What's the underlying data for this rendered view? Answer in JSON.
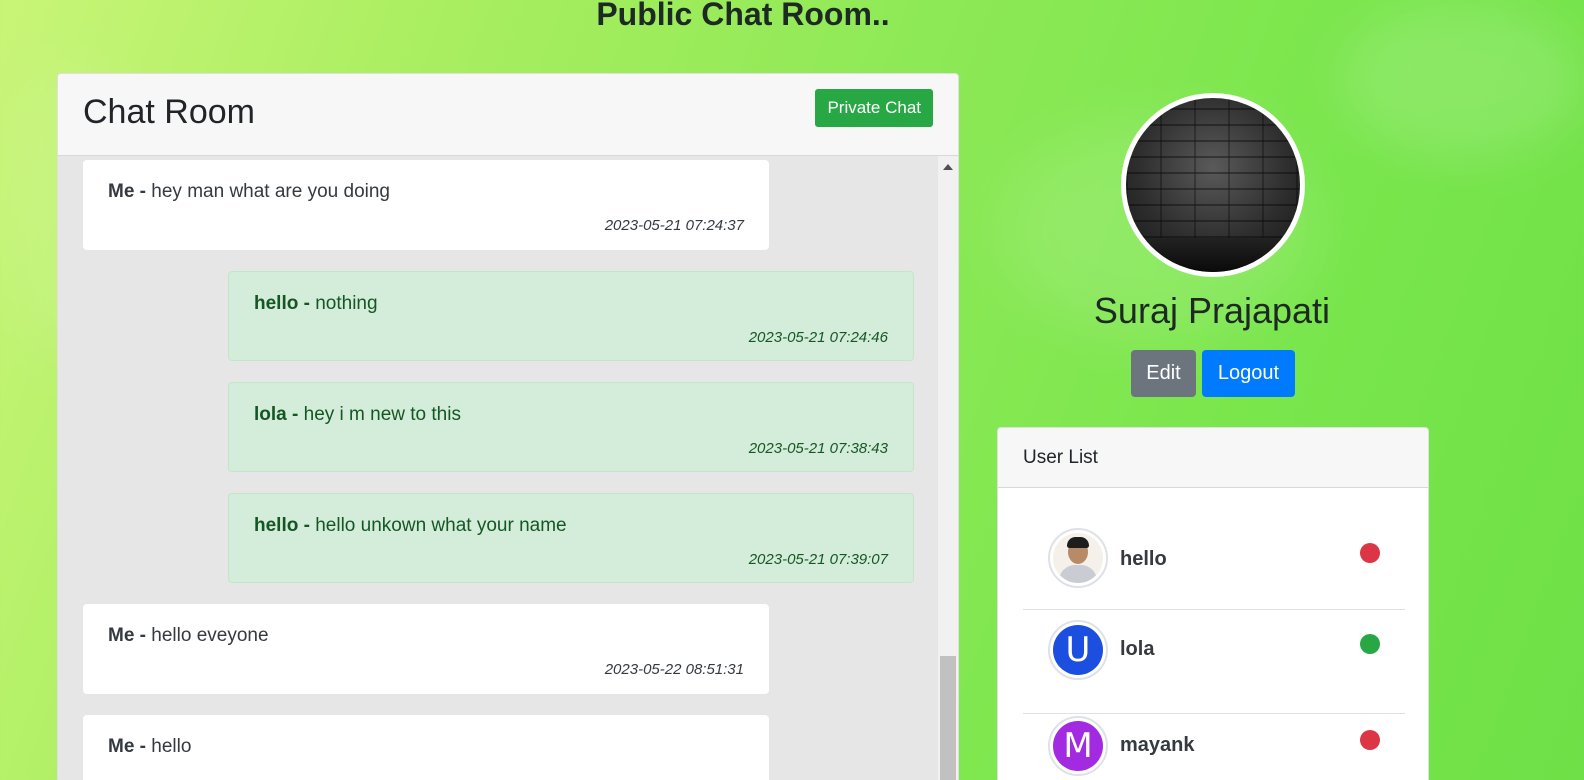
{
  "page": {
    "title": "Public Chat Room.."
  },
  "chat": {
    "title": "Chat Room",
    "private_chat_label": "Private Chat",
    "messages": [
      {
        "sender": "Me",
        "separator": " - ",
        "text": "hey man what are you doing",
        "time": "2023-05-21 07:24:37",
        "own": true
      },
      {
        "sender": "hello",
        "separator": " - ",
        "text": "nothing",
        "time": "2023-05-21 07:24:46",
        "own": false
      },
      {
        "sender": "lola",
        "separator": " - ",
        "text": "hey i m new to this",
        "time": "2023-05-21 07:38:43",
        "own": false
      },
      {
        "sender": "hello",
        "separator": " - ",
        "text": "hello unkown what your name",
        "time": "2023-05-21 07:39:07",
        "own": false
      },
      {
        "sender": "Me",
        "separator": " - ",
        "text": "hello eveyone",
        "time": "2023-05-22 08:51:31",
        "own": true
      },
      {
        "sender": "Me",
        "separator": " - ",
        "text": "hello",
        "time": "",
        "own": true
      }
    ]
  },
  "profile": {
    "name": "Suraj Prajapati",
    "edit_label": "Edit",
    "logout_label": "Logout"
  },
  "user_list": {
    "title": "User List",
    "users": [
      {
        "name": "hello",
        "avatar_type": "photo",
        "initial": "",
        "avatar_color": "",
        "status": "offline",
        "status_color": "#dc3545"
      },
      {
        "name": "lola",
        "avatar_type": "initial",
        "initial": "U",
        "avatar_color": "#1c4fe0",
        "status": "online",
        "status_color": "#28a745"
      },
      {
        "name": "mayank",
        "avatar_type": "initial",
        "initial": "M",
        "avatar_color": "#a22be2",
        "status": "offline",
        "status_color": "#dc3545"
      }
    ]
  }
}
